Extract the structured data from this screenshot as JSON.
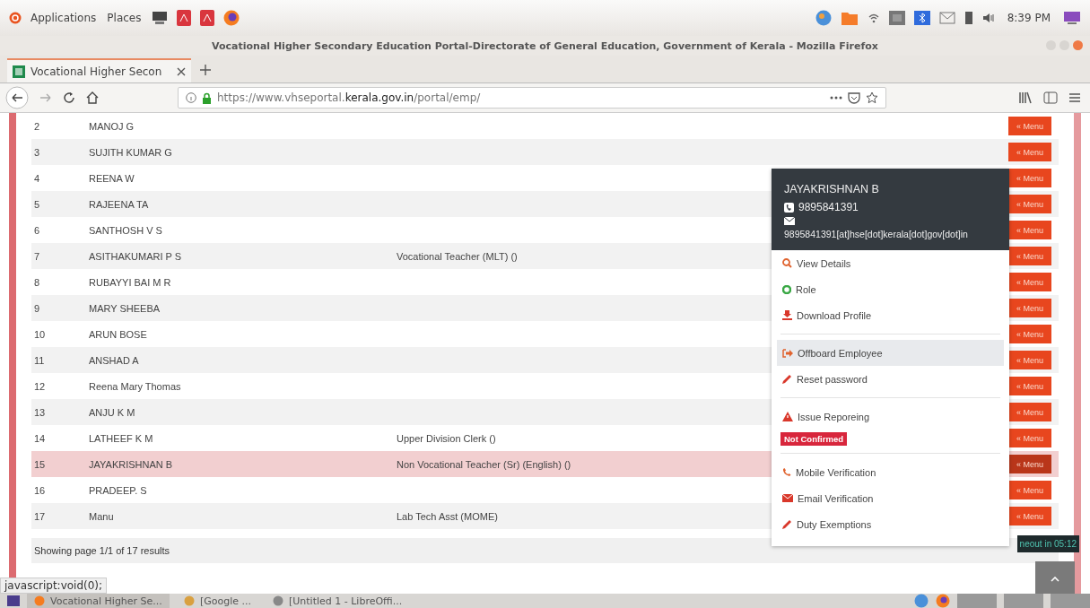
{
  "top_panel": {
    "menus": [
      "Applications",
      "Places"
    ],
    "clock": "8:39 PM"
  },
  "window": {
    "title": "Vocational Higher Secondary Education Portal-Directorate of General Education, Government of Kerala - Mozilla Firefox"
  },
  "tabs": [
    {
      "label": "Vocational Higher Secon",
      "selected": true
    }
  ],
  "address_bar": {
    "url_plain": "https://www.vhseportal.",
    "url_domain": "kerala.gov.in",
    "url_path": "/portal/emp/"
  },
  "table": {
    "rows": [
      {
        "number": "2",
        "name": "MANOJ G",
        "designation": "",
        "menu": "« Menu",
        "selected": false
      },
      {
        "number": "3",
        "name": "SUJITH KUMAR G",
        "designation": "",
        "menu": "« Menu",
        "selected": false
      },
      {
        "number": "4",
        "name": "REENA W",
        "designation": "",
        "menu": "« Menu",
        "selected": false
      },
      {
        "number": "5",
        "name": "RAJEENA TA",
        "designation": "",
        "menu": "« Menu",
        "selected": false
      },
      {
        "number": "6",
        "name": "SANTHOSH V S",
        "designation": "",
        "menu": "« Menu",
        "selected": false
      },
      {
        "number": "7",
        "name": "ASITHAKUMARI P S",
        "designation": "Vocational Teacher (MLT) ()",
        "menu": "« Menu",
        "selected": false
      },
      {
        "number": "8",
        "name": "RUBAYYI BAI M R",
        "designation": "",
        "menu": "« Menu",
        "selected": false
      },
      {
        "number": "9",
        "name": "MARY SHEEBA",
        "designation": "",
        "menu": "« Menu",
        "selected": false
      },
      {
        "number": "10",
        "name": "ARUN BOSE",
        "designation": "",
        "menu": "« Menu",
        "selected": false
      },
      {
        "number": "11",
        "name": "ANSHAD A",
        "designation": "",
        "menu": "« Menu",
        "selected": false
      },
      {
        "number": "12",
        "name": "Reena Mary Thomas",
        "designation": "",
        "menu": "« Menu",
        "selected": false
      },
      {
        "number": "13",
        "name": "ANJU K M",
        "designation": "",
        "menu": "« Menu",
        "selected": false
      },
      {
        "number": "14",
        "name": "LATHEEF K M",
        "designation": "Upper Division Clerk ()",
        "menu": "« Menu",
        "selected": false
      },
      {
        "number": "15",
        "name": "JAYAKRISHNAN B",
        "designation": "Non Vocational Teacher (Sr) (English) ()",
        "menu": "« Menu",
        "selected": true
      },
      {
        "number": "16",
        "name": "PRADEEP. S",
        "designation": "",
        "menu": "« Menu",
        "selected": false
      },
      {
        "number": "17",
        "name": "Manu",
        "designation": "Lab Tech Asst (MOME)",
        "menu": "« Menu",
        "selected": false
      }
    ],
    "footer": "Showing page 1/1 of 17 results"
  },
  "popup": {
    "name": "JAYAKRISHNAN B",
    "phone": "9895841391",
    "email": "9895841391[at]hse[dot]kerala[dot]gov[dot]in",
    "groups": [
      [
        {
          "label": "View Details",
          "selected": false
        },
        {
          "label": "Role",
          "selected": false
        },
        {
          "label": "Download Profile",
          "selected": false
        }
      ],
      [
        {
          "label": "Offboard Employee",
          "selected": true
        },
        {
          "label": "Reset password",
          "selected": false
        }
      ],
      [
        {
          "label": "Issue Reporeing",
          "selected": false,
          "badge": "Not Confirmed"
        }
      ],
      [
        {
          "label": "Mobile Verification",
          "selected": false
        },
        {
          "label": "Email Verification",
          "selected": false
        },
        {
          "label": "Duty Exemptions",
          "selected": false
        }
      ]
    ]
  },
  "timeout": "neout in 05:12",
  "status_link": "javascript:void(0);",
  "taskbar": [
    {
      "label": "Vocational Higher Se...",
      "selected": true
    },
    {
      "label": "[Google ...",
      "selected": false
    },
    {
      "label": "[Untitled 1 - LibreOffi...",
      "selected": false
    }
  ]
}
